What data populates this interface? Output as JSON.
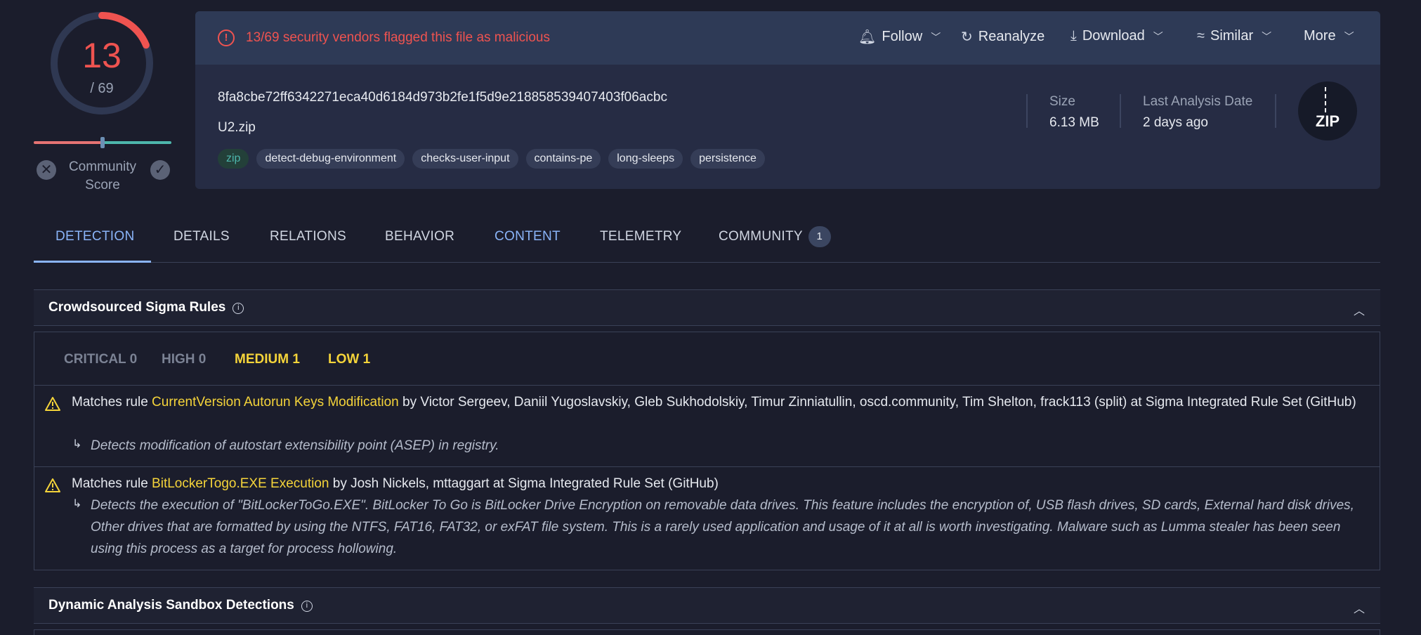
{
  "score": {
    "flagged": "13",
    "total": "/ 69",
    "community_label": "Community Score",
    "fraction": 0.188
  },
  "alert": {
    "text": "13/69 security vendors flagged this file as malicious"
  },
  "actions": [
    {
      "label": "Follow",
      "icon": "bell-icon"
    },
    {
      "label": "Reanalyze",
      "icon": "refresh-icon"
    },
    {
      "label": "Download",
      "icon": "download-icon"
    },
    {
      "label": "Similar",
      "icon": "similar-icon"
    },
    {
      "label": "More",
      "icon": "chevron-down-icon"
    }
  ],
  "file": {
    "hash": "8fa8cbe72ff6342271eca40d6184d973b2fe1f5d9e218858539407403f06acbc",
    "name": "U2.zip",
    "tags": [
      "zip",
      "detect-debug-environment",
      "checks-user-input",
      "contains-pe",
      "long-sleeps",
      "persistence"
    ],
    "size_label": "Size",
    "size_value": "6.13 MB",
    "date_label": "Last Analysis Date",
    "date_value": "2 days ago",
    "type_icon_label": "ZIP"
  },
  "tabs": [
    {
      "label": "DETECTION"
    },
    {
      "label": "DETAILS"
    },
    {
      "label": "RELATIONS"
    },
    {
      "label": "BEHAVIOR"
    },
    {
      "label": "CONTENT"
    },
    {
      "label": "TELEMETRY"
    },
    {
      "label": "COMMUNITY",
      "badge": "1"
    }
  ],
  "sigma": {
    "title": "Crowdsourced Sigma Rules",
    "severities": [
      {
        "label": "CRITICAL 0",
        "color": "#7b8294"
      },
      {
        "label": "HIGH 0",
        "color": "#7b8294"
      },
      {
        "label": "MEDIUM 1",
        "color": "#f5d43a"
      },
      {
        "label": "LOW 1",
        "color": "#f5d43a"
      }
    ],
    "rules": [
      {
        "prefix": "Matches rule ",
        "name": "CurrentVersion Autorun Keys Modification",
        "suffix": " by Victor Sergeev, Daniil Yugoslavskiy, Gleb Sukhodolskiy, Timur Zinniatullin, oscd.community, Tim Shelton, frack113 (split) at Sigma Integrated Rule Set (GitHub)",
        "description": "Detects modification of autostart extensibility point (ASEP) in registry."
      },
      {
        "prefix": "Matches rule ",
        "name": "BitLockerTogo.EXE Execution",
        "suffix": " by Josh Nickels, mttaggart at Sigma Integrated Rule Set (GitHub)",
        "description": "Detects the execution of \"BitLockerToGo.EXE\". BitLocker To Go is BitLocker Drive Encryption on removable data drives. This feature includes the encryption of, USB flash drives, SD cards, External hard disk drives, Other drives that are formatted by using the NTFS, FAT16, FAT32, or exFAT file system. This is a rarely used application and usage of it at all is worth investigating. Malware such as Lumma stealer has been seen using this process as a target for process hollowing."
      }
    ]
  },
  "sandbox": {
    "title": "Dynamic Analysis Sandbox Detections"
  },
  "colors": {
    "accent": "#8ab4f8",
    "danger": "#ef5350",
    "warning": "#f5d43a",
    "ok": "#4db6ac"
  }
}
